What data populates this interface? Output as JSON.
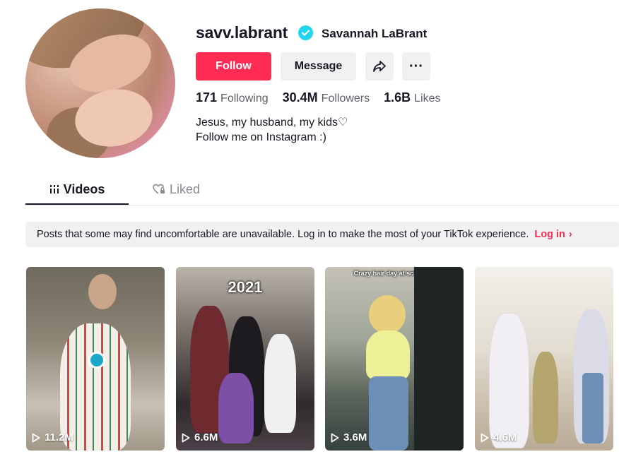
{
  "profile": {
    "username": "savv.labrant",
    "display_name": "Savannah LaBrant",
    "verified": true,
    "follow_label": "Follow",
    "message_label": "Message",
    "share_icon": "share-arrow-icon",
    "more_label": "···",
    "stats": [
      {
        "value": "171",
        "label": "Following"
      },
      {
        "value": "30.4M",
        "label": "Followers"
      },
      {
        "value": "1.6B",
        "label": "Likes"
      }
    ],
    "bio_line1": "Jesus, my husband, my kids♡",
    "bio_line2": "Follow me on Instagram :)"
  },
  "tabs": [
    {
      "label": "Videos",
      "icon": "grid-icon",
      "active": true
    },
    {
      "label": "Liked",
      "icon": "heart-lock-icon",
      "active": false
    }
  ],
  "notice": {
    "text": "Posts that some may find uncomfortable are unavailable. Log in to make the most of your TikTok experience.",
    "link": "Log in",
    "chevron": "›"
  },
  "videos": [
    {
      "views": "11.2M",
      "caption": ""
    },
    {
      "views": "6.6M",
      "caption": "2021"
    },
    {
      "views": "3.6M",
      "caption": "Crazy hair day at school🤪"
    },
    {
      "views": "4.6M",
      "caption": ""
    }
  ],
  "colors": {
    "accent": "#fe2c55",
    "verified": "#20d5ec",
    "text": "#161823",
    "muted": "#5e6068",
    "surface": "#f1f1f2"
  }
}
